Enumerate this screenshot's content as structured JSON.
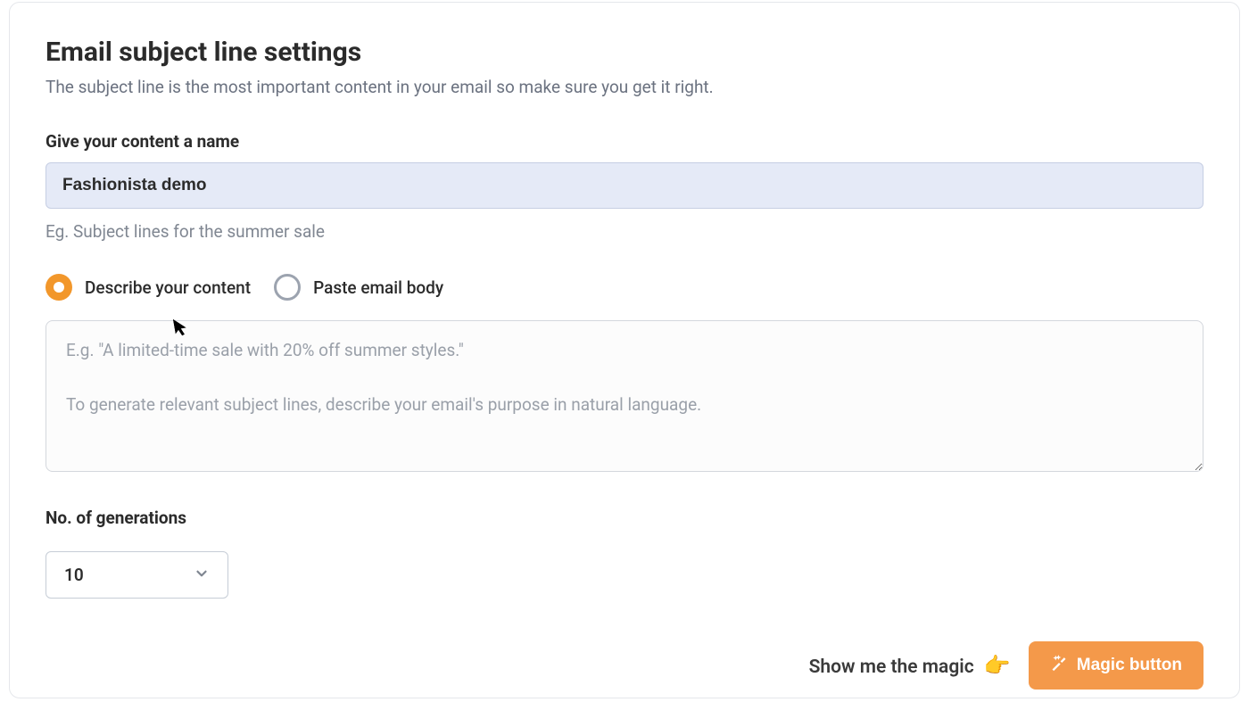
{
  "heading": "Email subject line settings",
  "subheading": "The subject line is the most important content in your email so make sure you get it right.",
  "content_name": {
    "label": "Give your content a name",
    "value": "Fashionista demo",
    "helper": "Eg. Subject lines for the summer sale"
  },
  "input_mode": {
    "options": [
      {
        "label": "Describe your content",
        "selected": true
      },
      {
        "label": "Paste email body",
        "selected": false
      }
    ]
  },
  "description": {
    "value": "",
    "placeholder": "E.g. \"A limited-time sale with 20% off summer styles.\"\n\nTo generate relevant subject lines, describe your email's purpose in natural language."
  },
  "generations": {
    "label": "No. of generations",
    "selected": "10"
  },
  "cta": {
    "text": "Show me the magic",
    "button": "Magic button"
  }
}
